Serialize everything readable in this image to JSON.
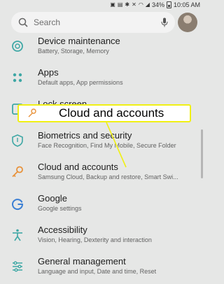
{
  "status_bar": {
    "battery": "34%",
    "time": "10:05 AM"
  },
  "search": {
    "placeholder": "Search"
  },
  "callout": {
    "label": "Cloud and accounts"
  },
  "items": [
    {
      "title": "Device maintenance",
      "subtitle": "Battery, Storage, Memory",
      "icon": "device-maintenance-icon"
    },
    {
      "title": "Apps",
      "subtitle": "Default apps, App permissions",
      "icon": "apps-icon"
    },
    {
      "title": "Lock screen",
      "subtitle": "",
      "icon": "lock-screen-icon"
    },
    {
      "title": "Biometrics and security",
      "subtitle": "Face Recognition, Find My Mobile, Secure Folder",
      "icon": "shield-icon"
    },
    {
      "title": "Cloud and accounts",
      "subtitle": "Samsung Cloud, Backup and restore, Smart Swi...",
      "icon": "key-icon"
    },
    {
      "title": "Google",
      "subtitle": "Google settings",
      "icon": "google-icon"
    },
    {
      "title": "Accessibility",
      "subtitle": "Vision, Hearing, Dexterity and interaction",
      "icon": "accessibility-icon"
    },
    {
      "title": "General management",
      "subtitle": "Language and input, Date and time, Reset",
      "icon": "sliders-icon"
    }
  ],
  "colors": {
    "accent": "#f0f015",
    "icon_teal": "#3fa8a5",
    "icon_orange": "#e8923a"
  }
}
